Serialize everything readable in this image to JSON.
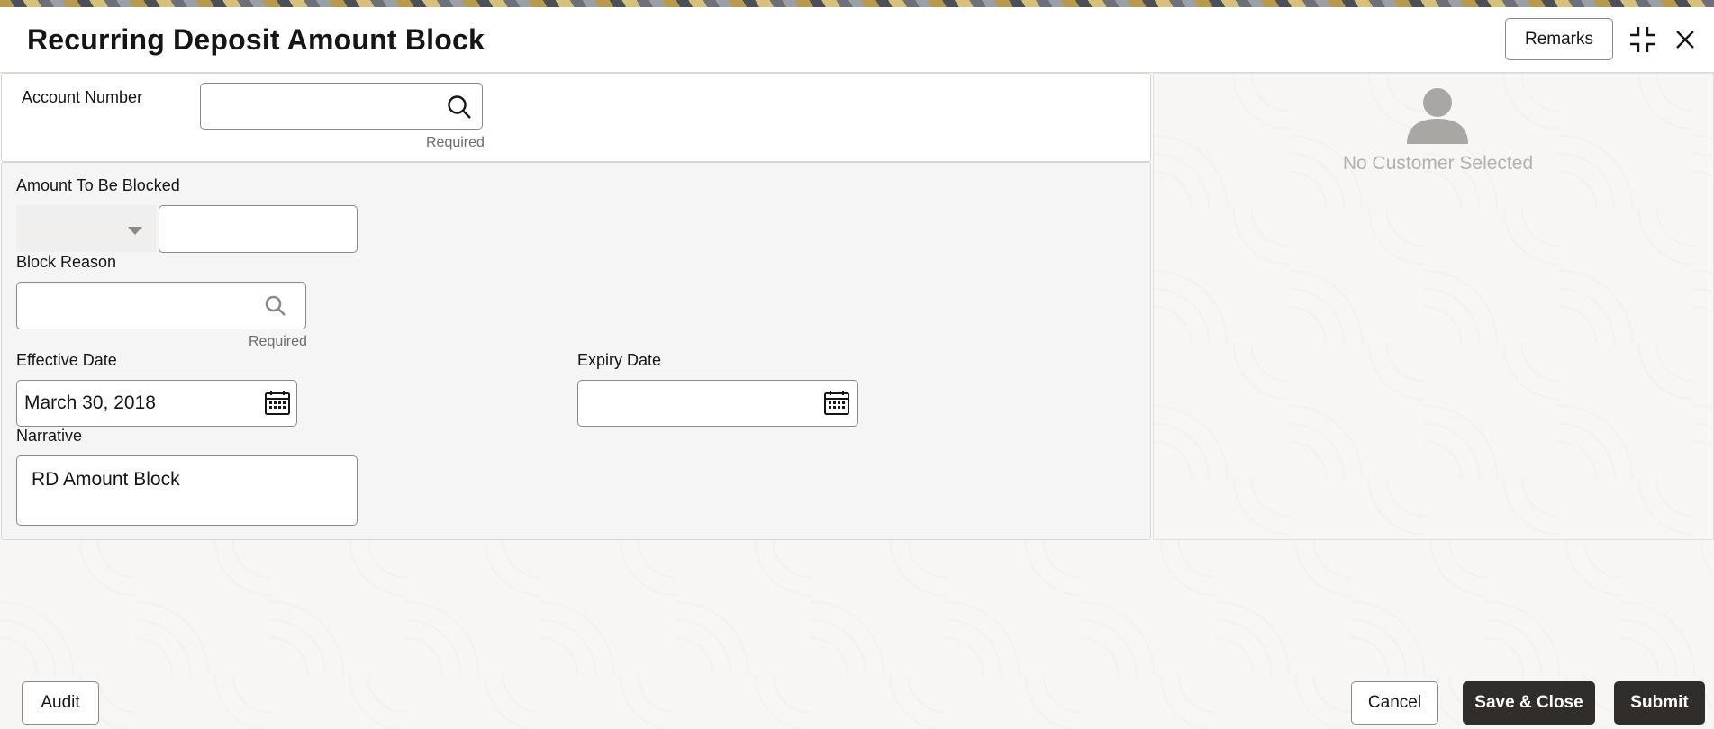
{
  "header": {
    "title": "Recurring Deposit Amount Block",
    "remarks_label": "Remarks"
  },
  "form": {
    "account_number": {
      "label": "Account Number",
      "value": "",
      "helper": "Required"
    },
    "amount_to_be_blocked": {
      "label": "Amount To Be Blocked",
      "currency": "",
      "value": ""
    },
    "block_reason": {
      "label": "Block Reason",
      "value": "",
      "helper": "Required"
    },
    "effective_date": {
      "label": "Effective Date",
      "value": "March 30, 2018"
    },
    "expiry_date": {
      "label": "Expiry Date",
      "value": ""
    },
    "narrative": {
      "label": "Narrative",
      "value": "RD Amount Block"
    }
  },
  "customer_panel": {
    "status": "No Customer Selected"
  },
  "footer": {
    "audit_label": "Audit",
    "cancel_label": "Cancel",
    "save_close_label": "Save & Close",
    "submit_label": "Submit"
  },
  "icons": {
    "account_search": "search-icon",
    "block_reason_search": "search-icon",
    "calendar": "calendar-icon",
    "minimize": "minimize-icon",
    "close": "close-icon",
    "avatar": "user-avatar-icon"
  }
}
